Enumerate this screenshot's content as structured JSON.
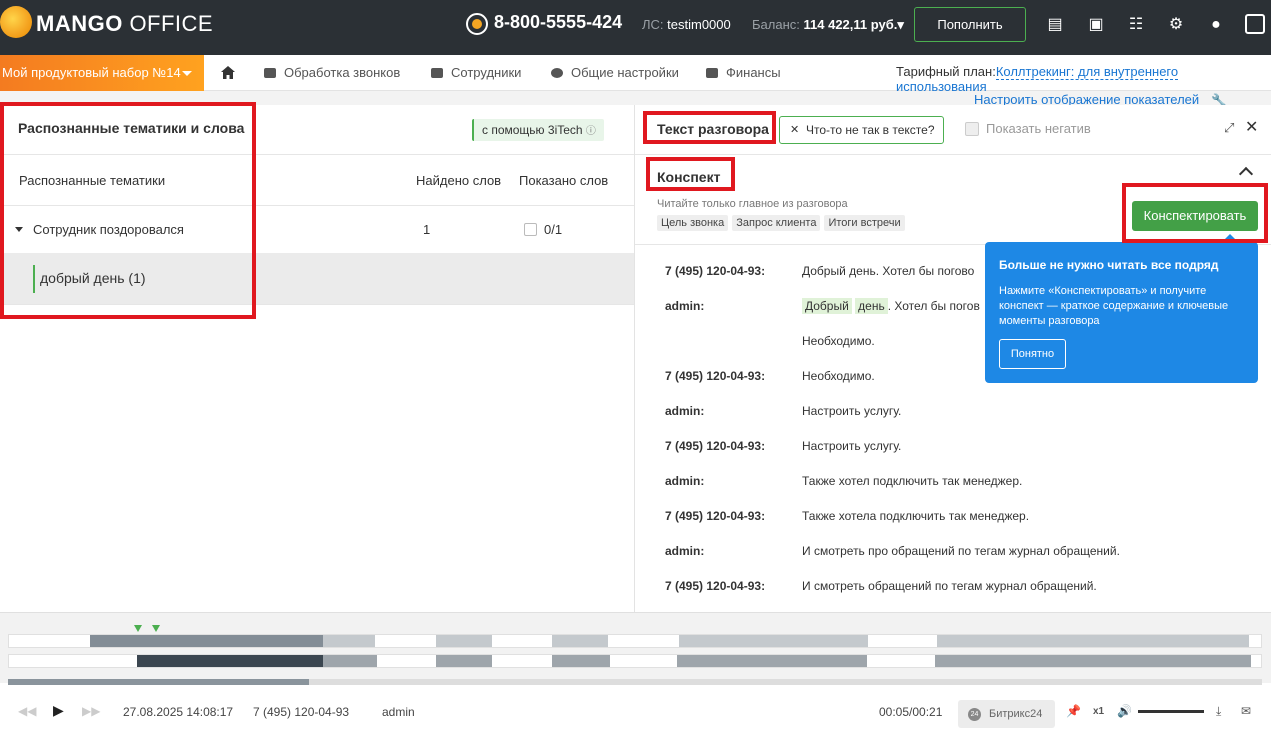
{
  "header": {
    "logo_bold": "MANGO",
    "logo_rest": " OFFICE",
    "phone": "8-800-5555-424",
    "ls_label": "ЛС:",
    "ls_value": "testim0000",
    "balance_label": "Баланс:",
    "balance_value": "114 422,11 руб.",
    "topup_label": "Пополнить"
  },
  "nav": {
    "product": "Мой продуктовый набор №14",
    "items": [
      "Обработка звонков",
      "Сотрудники",
      "Общие настройки",
      "Финансы"
    ],
    "tariff_label": "Тарифный план:",
    "tariff_value": "Коллтрекинг: для внутреннего использования",
    "configure_link": "Настроить отображение показателей"
  },
  "left_panel": {
    "title": "Распознанные тематики и слова",
    "badge": "с помощью 3iTech",
    "col_topics": "Распознанные тематики",
    "col_found": "Найдено слов",
    "col_shown": "Показано слов",
    "topic_name": "Сотрудник поздоровался",
    "topic_found": "1",
    "topic_shown": "0/1",
    "word": "добрый день (1)"
  },
  "right_panel": {
    "tab_title": "Текст разговора",
    "wrong_btn": "Что-то не так в тексте?",
    "negative_label": "Показать негатив",
    "konspekt_title": "Конспект",
    "hint": "Читайте только главное из разговора",
    "tags": [
      "Цель звонка",
      "Запрос клиента",
      "Итоги встречи"
    ],
    "konspekt_btn": "Конспектировать",
    "transcript": [
      {
        "speaker": "7 (495) 120-04-93:",
        "text": "Добрый день. Хотел бы погово"
      },
      {
        "speaker": "admin:",
        "text": "Хотел бы погов",
        "hl1": "Добрый",
        "hl2": "день",
        "sep": "."
      },
      {
        "speaker": "",
        "text": "Необходимо."
      },
      {
        "speaker": "7 (495) 120-04-93:",
        "text": "Необходимо."
      },
      {
        "speaker": "admin:",
        "text": "Настроить услугу."
      },
      {
        "speaker": "7 (495) 120-04-93:",
        "text": "Настроить услугу."
      },
      {
        "speaker": "admin:",
        "text": "Также хотел подключить так менеджер."
      },
      {
        "speaker": "7 (495) 120-04-93:",
        "text": "Также хотела подключить так менеджер."
      },
      {
        "speaker": "admin:",
        "text": "И смотреть про обращений по тегам журнал обращений."
      },
      {
        "speaker": "7 (495) 120-04-93:",
        "text": "И смотреть обращений по тегам журнал обращений."
      }
    ]
  },
  "tooltip": {
    "title": "Больше не нужно читать все подряд",
    "body": "Нажмите «Конспектировать» и получите конспект — краткое содержание и ключевые моменты разговора",
    "button": "Понятно"
  },
  "player": {
    "datetime": "27.08.2025 14:08:17",
    "number": "7 (495) 120-04-93",
    "user": "admin",
    "time": "00:05/00:21",
    "bitrix": "Битрикс24",
    "speed": "x1",
    "progress": 0.24
  }
}
